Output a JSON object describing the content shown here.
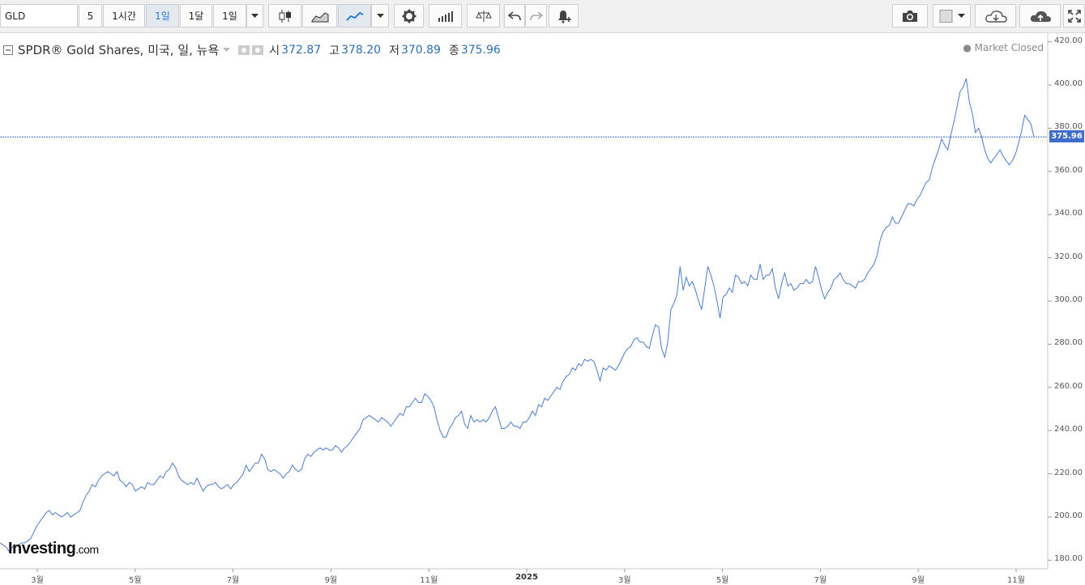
{
  "toolbar": {
    "symbol": "GLD",
    "btn_5": "5",
    "btn_1h": "1시간",
    "btn_1d": "1일",
    "btn_1m": "1달",
    "btn_interval": "1일",
    "icons": [
      "candlestick-icon",
      "area-chart-icon",
      "line-chart-icon",
      "settings-icon",
      "indicators-icon",
      "compare-icon",
      "undo-icon",
      "redo-icon",
      "alert-icon",
      "camera-icon",
      "color-swatch-icon",
      "cloud-download-icon",
      "cloud-upload-icon",
      "fullscreen-icon"
    ]
  },
  "legend": {
    "title": "SPDR® Gold Shares, 미국, 일, 뉴욕",
    "open_label": "시",
    "open": "372.87",
    "high_label": "고",
    "high": "378.20",
    "low_label": "저",
    "low": "370.89",
    "close_label": "종",
    "close": "375.96"
  },
  "status": "● Market Closed",
  "logo": {
    "brand": "Investing",
    "suffix": ".com"
  },
  "colors": {
    "line": "#4a7bd0",
    "price_label": "#3f6dcc",
    "accent": "#2d7bd6"
  },
  "chart_data": {
    "type": "line",
    "symbol": "GLD",
    "y_ticks": [
      "420.00",
      "400.00",
      "380.00",
      "360.00",
      "340.00",
      "320.00",
      "300.00",
      "280.00",
      "260.00",
      "240.00",
      "220.00",
      "200.00",
      "180.00"
    ],
    "x_ticks": [
      {
        "label": "3월",
        "bold": false
      },
      {
        "label": "5월",
        "bold": false
      },
      {
        "label": "7월",
        "bold": false
      },
      {
        "label": "9월",
        "bold": false
      },
      {
        "label": "11월",
        "bold": false
      },
      {
        "label": "2025",
        "bold": true
      },
      {
        "label": "3월",
        "bold": false
      },
      {
        "label": "5월",
        "bold": false
      },
      {
        "label": "7월",
        "bold": false
      },
      {
        "label": "9월",
        "bold": false
      },
      {
        "label": "11월",
        "bold": false
      }
    ],
    "ylim": [
      176,
      424
    ],
    "last_price": "375.96",
    "series": [
      {
        "values": [
          188,
          187,
          186,
          184,
          186,
          187,
          187,
          188,
          188,
          189,
          190,
          193,
          196,
          198,
          200,
          202,
          203,
          201,
          202,
          201,
          200,
          201,
          202,
          200,
          201,
          202,
          203,
          207,
          210,
          212,
          215,
          214,
          217,
          219,
          220,
          221,
          220,
          219,
          221,
          217,
          216,
          214,
          216,
          215,
          212,
          213,
          214,
          213,
          216,
          215,
          215,
          217,
          219,
          218,
          221,
          222,
          225,
          223,
          219,
          217,
          216,
          215,
          216,
          215,
          218,
          215,
          212,
          214,
          215,
          215,
          216,
          214,
          213,
          214,
          215,
          213,
          215,
          216,
          218,
          220,
          224,
          221,
          223,
          225,
          225,
          229,
          227,
          222,
          221,
          222,
          221,
          220,
          218,
          220,
          221,
          224,
          222,
          221,
          222,
          227,
          229,
          228,
          230,
          231,
          232,
          231,
          232,
          231,
          231,
          233,
          232,
          230,
          232,
          233,
          235,
          237,
          239,
          241,
          245,
          246,
          247,
          246,
          245,
          244,
          246,
          245,
          244,
          242,
          244,
          246,
          248,
          247,
          251,
          251,
          253,
          255,
          253,
          253,
          257,
          256,
          254,
          251,
          245,
          240,
          237,
          237,
          241,
          243,
          246,
          247,
          249,
          243,
          241,
          247,
          244,
          245,
          244,
          245,
          244,
          246,
          249,
          251,
          246,
          241,
          241,
          242,
          244,
          242,
          242,
          241,
          244,
          244,
          246,
          249,
          247,
          252,
          251,
          255,
          254,
          256,
          258,
          260,
          259,
          263,
          265,
          266,
          269,
          268,
          271,
          270,
          273,
          272,
          273,
          272,
          268,
          263,
          269,
          268,
          270,
          269,
          268,
          270,
          273,
          276,
          278,
          279,
          282,
          283,
          281,
          281,
          279,
          278,
          284,
          289,
          288,
          278,
          274,
          281,
          296,
          299,
          303,
          316,
          305,
          311,
          307,
          309,
          305,
          300,
          296,
          306,
          316,
          312,
          307,
          300,
          292,
          302,
          303,
          306,
          304,
          312,
          311,
          308,
          309,
          307,
          312,
          310,
          310,
          317,
          310,
          312,
          312,
          315,
          306,
          301,
          308,
          313,
          307,
          308,
          305,
          306,
          308,
          308,
          310,
          308,
          309,
          316,
          311,
          305,
          301,
          304,
          306,
          310,
          311,
          313,
          310,
          308,
          308,
          307,
          306,
          309,
          309,
          310,
          313,
          315,
          317,
          321,
          328,
          332,
          334,
          335,
          339,
          336,
          336,
          339,
          342,
          345,
          345,
          344,
          347,
          349,
          352,
          355,
          356,
          362,
          366,
          370,
          375,
          372,
          370,
          377,
          383,
          390,
          397,
          399,
          403,
          392,
          387,
          378,
          380,
          376,
          370,
          366,
          364,
          366,
          368,
          370,
          367,
          365,
          363,
          365,
          368,
          373,
          379,
          386,
          384,
          382,
          376
        ]
      }
    ]
  }
}
